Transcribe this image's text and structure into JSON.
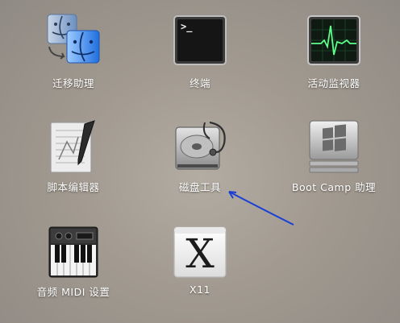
{
  "apps": [
    {
      "label": "迁移助理",
      "icon": "migration-assistant-icon"
    },
    {
      "label": "终端",
      "icon": "terminal-icon",
      "prompt": ">_"
    },
    {
      "label": "活动监视器",
      "icon": "activity-monitor-icon"
    },
    {
      "label": "脚本编辑器",
      "icon": "script-editor-icon"
    },
    {
      "label": "磁盘工具",
      "icon": "disk-utility-icon"
    },
    {
      "label": "Boot Camp 助理",
      "icon": "boot-camp-icon"
    },
    {
      "label": "音频 MIDI 设置",
      "icon": "audio-midi-setup-icon"
    },
    {
      "label": "X11",
      "icon": "x11-icon",
      "glyph": "X"
    }
  ],
  "annotation": {
    "arrow_color": "#1a3fd6"
  }
}
